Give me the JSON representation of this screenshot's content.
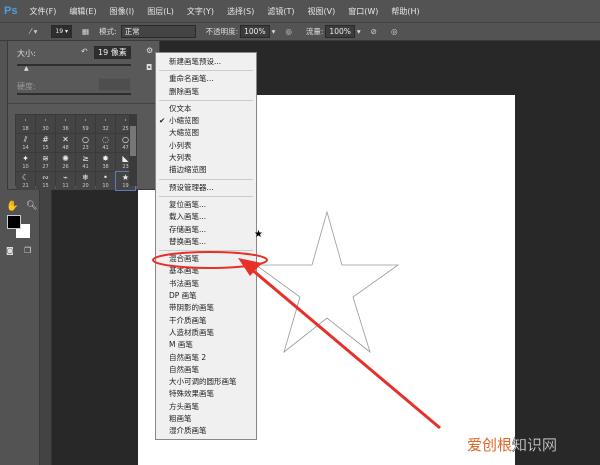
{
  "app": {
    "logo": "Ps"
  },
  "menubar": [
    "文件(F)",
    "编辑(E)",
    "图像(I)",
    "图层(L)",
    "文字(Y)",
    "选择(S)",
    "滤镜(T)",
    "视图(V)",
    "窗口(W)",
    "帮助(H)"
  ],
  "options": {
    "brush_size": "19",
    "mode_label": "模式:",
    "mode_value": "正常",
    "opacity_label": "不透明度:",
    "opacity_value": "100%",
    "flow_label": "流量:",
    "flow_value": "100%"
  },
  "brush_panel": {
    "size_label": "大小:",
    "size_value": "19 像素",
    "hardness_label": "硬度:",
    "brushes": [
      "18",
      "30",
      "36",
      "59",
      "32",
      "25",
      "14",
      "15",
      "48",
      "23",
      "41",
      "47",
      "10",
      "27",
      "26",
      "41",
      "38",
      "23",
      "21",
      "15",
      "11",
      "20",
      "10",
      "19"
    ],
    "selected_brush": "19",
    "size_slider_fraction": 0.12
  },
  "context_menu": {
    "groups": [
      [
        "新建画笔预设..."
      ],
      [
        "重命名画笔...",
        "删除画笔"
      ],
      [
        "仅文本",
        "小缩览图",
        "大缩览图",
        "小列表",
        "大列表",
        "描边缩览图"
      ],
      [
        "预设管理器..."
      ],
      [
        "复位画笔...",
        "载入画笔...",
        "存储画笔...",
        "替换画笔..."
      ],
      [
        "混合画笔",
        "基本画笔",
        "书法画笔",
        "DP 画笔",
        "带阴影的画笔",
        "干介质画笔",
        "人造材质画笔",
        "M 画笔",
        "自然画笔 2",
        "自然画笔",
        "大小可调的圆形画笔",
        "特殊效果画笔",
        "方头画笔",
        "粗画笔",
        "湿介质画笔"
      ]
    ],
    "checked": "小缩览图",
    "highlighted": "混合画笔"
  },
  "colors": {
    "annotation": "#e8302a",
    "foreground": "#000000",
    "background": "#ffffff"
  },
  "watermark": {
    "a": "爱创根",
    "b": "知识网"
  }
}
